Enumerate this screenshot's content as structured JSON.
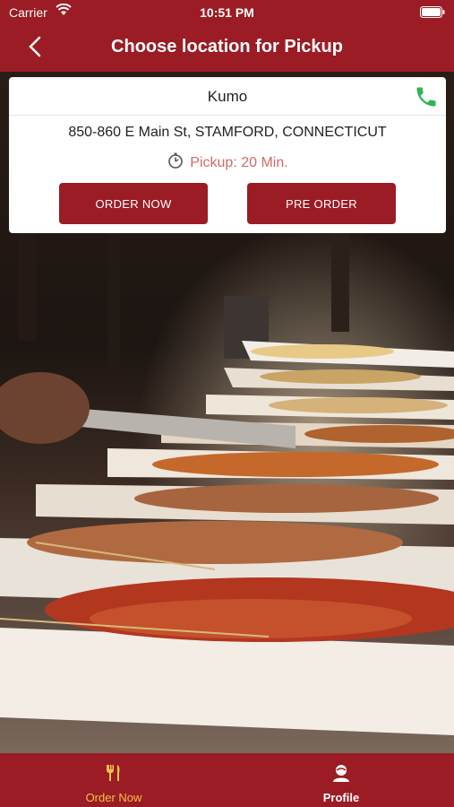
{
  "status": {
    "carrier": "Carrier",
    "time": "10:51 PM"
  },
  "nav": {
    "title": "Choose location for Pickup"
  },
  "card": {
    "restaurant_name": "Kumo",
    "address": "850-860 E Main St, STAMFORD, CONNECTICUT",
    "pickup_text": "Pickup: 20 Min.",
    "order_now_label": "ORDER NOW",
    "pre_order_label": "PRE ORDER"
  },
  "tabs": [
    {
      "label": "Order Now",
      "icon": "utensils-icon",
      "active": true
    },
    {
      "label": "Profile",
      "icon": "profile-icon",
      "active": false
    }
  ],
  "colors": {
    "brand": "#9b1c24",
    "active_tab": "#f0c24a",
    "pickup_text": "#d06a6a",
    "phone": "#2fb551"
  }
}
